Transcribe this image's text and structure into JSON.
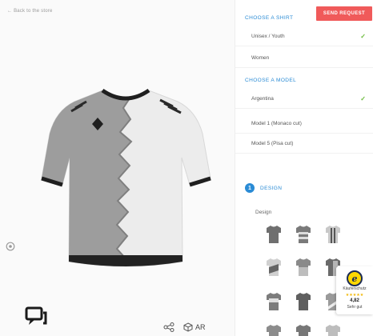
{
  "viewer": {
    "back_link": "← Back to the store",
    "ar_label": "AR"
  },
  "panel": {
    "send_request": "SEND REQUEST",
    "shirt_section": {
      "title": "CHOOSE A SHIRT",
      "options": [
        {
          "label": "Unisex / Youth",
          "selected": true
        },
        {
          "label": "Women",
          "selected": false
        }
      ]
    },
    "model_section": {
      "title": "CHOOSE A MODEL",
      "options": [
        {
          "label": "Argentina",
          "selected": true
        },
        {
          "label": "Model 1 (Monaco cut)",
          "selected": false
        },
        {
          "label": "Model 5 (Pisa cut)",
          "selected": false
        }
      ]
    },
    "design": {
      "step": "1",
      "label": "DESIGN",
      "sub_label": "Design"
    }
  },
  "trust_badge": {
    "logo_letter": "e",
    "label": "Käuferschutz",
    "stars": "★★★★★",
    "score": "4,82",
    "grade": "Sehr gut"
  },
  "colors": {
    "accent": "#2a8bd5",
    "send_button": "#f05a5a",
    "check": "#6cbb3c",
    "shirt_light": "#ececec",
    "shirt_dark": "#9d9d9d"
  },
  "icons": [
    "chat-icon",
    "share-icon",
    "ar-cube-icon",
    "layers-icon",
    "check-icon"
  ]
}
